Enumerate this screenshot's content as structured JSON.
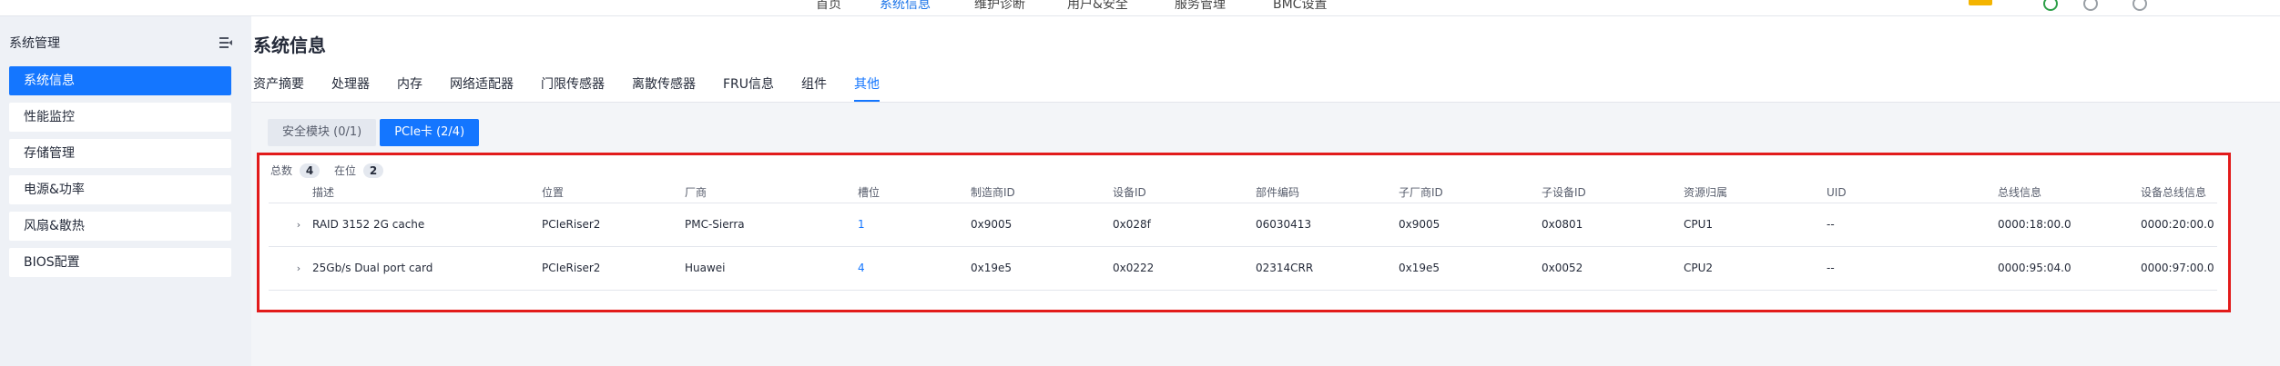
{
  "topnav": {
    "items": [
      "首页",
      "系统信息",
      "维护诊断",
      "用户&安全",
      "服务管理",
      "BMC设置"
    ],
    "active_index": 1
  },
  "sidebar": {
    "title": "系统管理",
    "items": [
      {
        "label": "系统信息",
        "active": true
      },
      {
        "label": "性能监控",
        "active": false
      },
      {
        "label": "存储管理",
        "active": false
      },
      {
        "label": "电源&功率",
        "active": false
      },
      {
        "label": "风扇&散热",
        "active": false
      },
      {
        "label": "BIOS配置",
        "active": false
      }
    ]
  },
  "page": {
    "title": "系统信息",
    "tabs": [
      "资产摘要",
      "处理器",
      "内存",
      "网络适配器",
      "门限传感器",
      "离散传感器",
      "FRU信息",
      "组件",
      "其他"
    ],
    "active_tab": 8
  },
  "subtabs": [
    {
      "label": "安全模块 (0/1)",
      "active": false
    },
    {
      "label": "PCIe卡 (2/4)",
      "active": true
    }
  ],
  "stats": {
    "total_label": "总数",
    "total_value": "4",
    "present_label": "在位",
    "present_value": "2"
  },
  "table": {
    "headers": [
      "描述",
      "位置",
      "厂商",
      "槽位",
      "制造商ID",
      "设备ID",
      "部件编码",
      "子厂商ID",
      "子设备ID",
      "资源归属",
      "UID",
      "总线信息",
      "设备总线信息"
    ],
    "rows": [
      [
        "RAID 3152 2G cache",
        "PCIeRiser2",
        "PMC-Sierra",
        "1",
        "0x9005",
        "0x028f",
        "06030413",
        "0x9005",
        "0x0801",
        "CPU1",
        "--",
        "0000:18:00.0",
        "0000:20:00.0"
      ],
      [
        "25Gb/s Dual port card",
        "PCIeRiser2",
        "Huawei",
        "4",
        "0x19e5",
        "0x0222",
        "02314CRR",
        "0x19e5",
        "0x0052",
        "CPU2",
        "--",
        "0000:95:04.0",
        "0000:97:00.0"
      ]
    ]
  },
  "colors": {
    "accent": "#1476ff",
    "highlight_border": "#e21b1b"
  }
}
